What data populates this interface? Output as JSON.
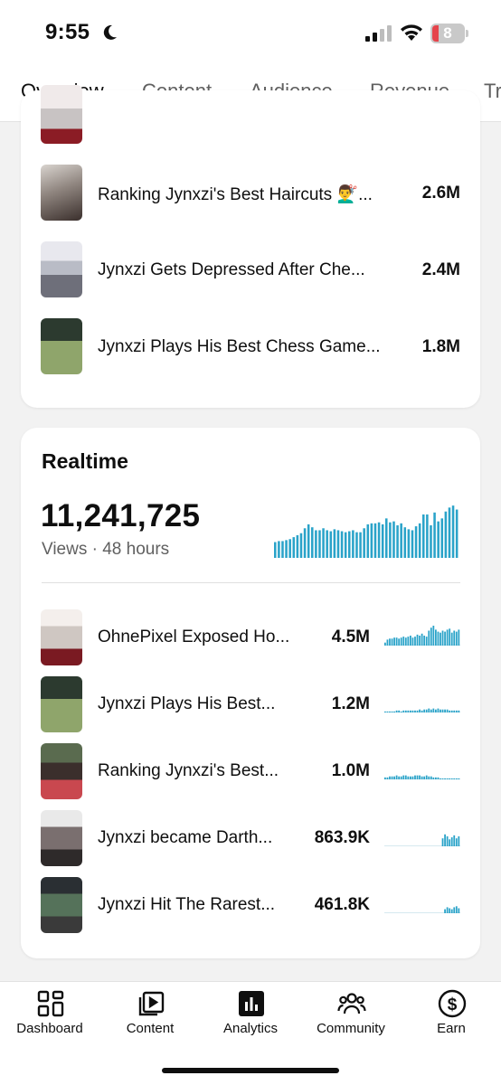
{
  "status_bar": {
    "time": "9:55",
    "battery": "8"
  },
  "tabs": [
    {
      "label": "Overview",
      "active": true
    },
    {
      "label": "Content",
      "active": false
    },
    {
      "label": "Audience",
      "active": false
    },
    {
      "label": "Revenue",
      "active": false
    },
    {
      "label": "Tr",
      "active": false
    }
  ],
  "top_videos": [
    {
      "title": "Ranking Jynxzi's Best Haircuts 💇‍♂️...",
      "views": "2.6M"
    },
    {
      "title": "Jynxzi Gets Depressed After Che...",
      "views": "2.4M"
    },
    {
      "title": "Jynxzi Plays His Best Chess Game...",
      "views": "1.8M"
    }
  ],
  "realtime": {
    "title": "Realtime",
    "views": "11,241,725",
    "subtitle": "Views · 48 hours",
    "accent": "#2aa3c9",
    "chart_data": {
      "type": "bar",
      "values": [
        16,
        17,
        17,
        18,
        19,
        21,
        23,
        25,
        30,
        34,
        31,
        28,
        28,
        30,
        28,
        27,
        29,
        28,
        27,
        26,
        27,
        28,
        26,
        26,
        30,
        34,
        35,
        35,
        36,
        34,
        40,
        36,
        37,
        33,
        35,
        31,
        29,
        28,
        32,
        35,
        44,
        44,
        33,
        46,
        37,
        40,
        47,
        51,
        53,
        49
      ]
    },
    "videos": [
      {
        "title": "OhnePixel Exposed Ho...",
        "views": "4.5M",
        "bars": [
          3,
          6,
          7,
          7,
          8,
          8,
          7,
          8,
          9,
          8,
          9,
          10,
          8,
          9,
          11,
          10,
          12,
          10,
          9,
          15,
          18,
          20,
          16,
          14,
          13,
          15,
          14,
          16,
          17,
          13,
          15,
          14,
          16
        ]
      },
      {
        "title": "Jynxzi Plays His Best...",
        "views": "1.2M",
        "bars": [
          1,
          1,
          1,
          1,
          1,
          2,
          2,
          1,
          2,
          2,
          2,
          2,
          2,
          2,
          2,
          3,
          2,
          3,
          3,
          4,
          3,
          4,
          3,
          4,
          3,
          3,
          3,
          3,
          2,
          2,
          2,
          2,
          2
        ]
      },
      {
        "title": "Ranking Jynxzi's Best...",
        "views": "1.0M",
        "bars": [
          2,
          2,
          3,
          3,
          3,
          4,
          3,
          3,
          4,
          4,
          3,
          3,
          3,
          4,
          4,
          4,
          3,
          3,
          4,
          3,
          3,
          2,
          2,
          2,
          1,
          1,
          1,
          1,
          1,
          1,
          1,
          1,
          1
        ]
      },
      {
        "title": "Jynxzi became Darth...",
        "views": "863.9K",
        "bars": [
          0,
          0,
          0,
          0,
          0,
          0,
          0,
          0,
          0,
          0,
          0,
          0,
          0,
          0,
          0,
          0,
          0,
          0,
          0,
          0,
          0,
          0,
          0,
          0,
          0,
          8,
          12,
          10,
          7,
          9,
          11,
          8,
          10
        ]
      },
      {
        "title": "Jynxzi Hit The Rarest...",
        "views": "461.8K",
        "bars": [
          0,
          0,
          0,
          0,
          0,
          0,
          0,
          0,
          0,
          0,
          0,
          0,
          0,
          0,
          0,
          0,
          0,
          0,
          0,
          0,
          0,
          0,
          0,
          0,
          0,
          0,
          4,
          6,
          5,
          4,
          6,
          7,
          5
        ]
      }
    ]
  },
  "bottom_nav": [
    {
      "label": "Dashboard",
      "icon": "dashboard-icon"
    },
    {
      "label": "Content",
      "icon": "content-icon"
    },
    {
      "label": "Analytics",
      "icon": "analytics-icon"
    },
    {
      "label": "Community",
      "icon": "community-icon"
    },
    {
      "label": "Earn",
      "icon": "earn-icon"
    }
  ]
}
